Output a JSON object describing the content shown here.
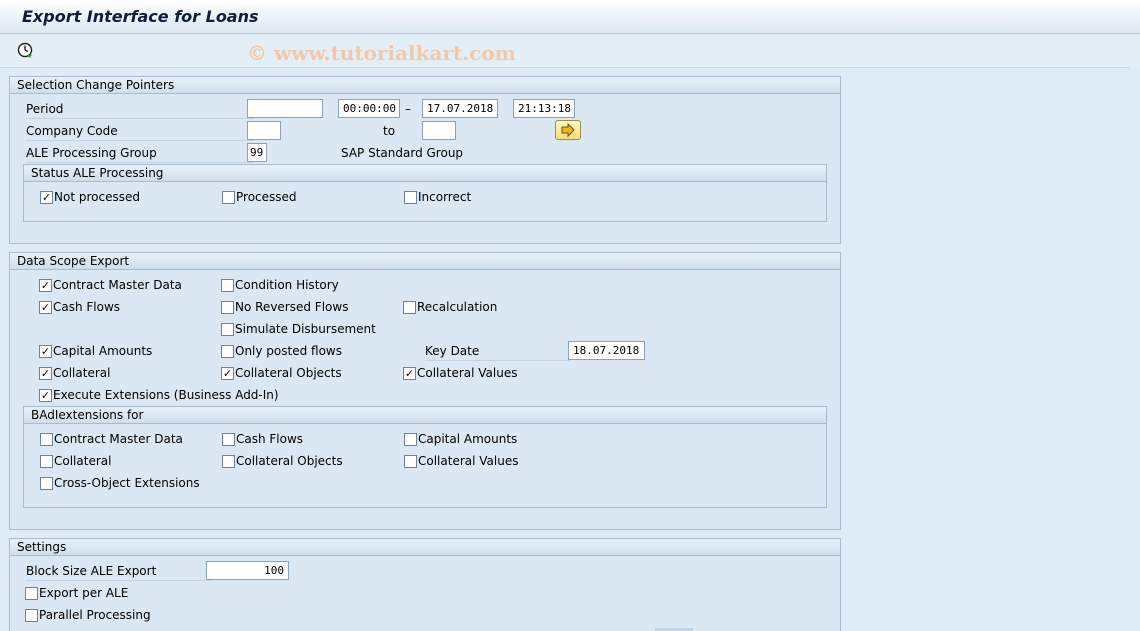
{
  "window": {
    "title": "Export Interface for Loans"
  },
  "toolbar": {
    "execute_icon": "clock-execute-icon",
    "watermark": "© www.tutorialkart.com"
  },
  "selection": {
    "frame_title": "Selection Change Pointers",
    "period_label": "Period",
    "period_from_date": "",
    "period_from_time": "00:00:00",
    "period_dash": "–",
    "period_to_date": "17.07.2018",
    "period_to_time": "21:13:18",
    "company_code_label": "Company Code",
    "company_code_from": "",
    "company_code_to_label": "to",
    "company_code_to": "",
    "ale_group_label": "ALE Processing Group",
    "ale_group_value": "99",
    "ale_group_text": "SAP Standard Group",
    "status_frame_title": "Status ALE Processing",
    "status": [
      {
        "label": "Not processed",
        "checked": true
      },
      {
        "label": "Processed",
        "checked": false
      },
      {
        "label": "Incorrect",
        "checked": false
      }
    ]
  },
  "scope": {
    "frame_title": "Data Scope Export",
    "items": {
      "contract_master_data": {
        "label": "Contract Master Data",
        "checked": true
      },
      "condition_history": {
        "label": "Condition History",
        "checked": false
      },
      "cash_flows": {
        "label": "Cash Flows",
        "checked": true
      },
      "no_reversed_flows": {
        "label": "No Reversed Flows",
        "checked": false
      },
      "recalculation": {
        "label": "Recalculation",
        "checked": false
      },
      "simulate_disbursement": {
        "label": "Simulate Disbursement",
        "checked": false
      },
      "capital_amounts": {
        "label": "Capital Amounts",
        "checked": true
      },
      "only_posted_flows": {
        "label": "Only posted flows",
        "checked": false
      },
      "collateral": {
        "label": "Collateral",
        "checked": true
      },
      "collateral_objects": {
        "label": "Collateral Objects",
        "checked": true
      },
      "collateral_values": {
        "label": "Collateral Values",
        "checked": true
      },
      "execute_extensions": {
        "label": "Execute Extensions (Business Add-In)",
        "checked": true
      }
    },
    "key_date_label": "Key Date",
    "key_date_value": "18.07.2018",
    "badi_frame_title": "BAdIextensions for",
    "badi": {
      "contract_master_data": {
        "label": "Contract Master Data",
        "checked": false
      },
      "cash_flows": {
        "label": "Cash Flows",
        "checked": false
      },
      "capital_amounts": {
        "label": "Capital Amounts",
        "checked": false
      },
      "collateral": {
        "label": "Collateral",
        "checked": false
      },
      "collateral_objects": {
        "label": "Collateral Objects",
        "checked": false
      },
      "collateral_values": {
        "label": "Collateral Values",
        "checked": false
      },
      "cross_object": {
        "label": "Cross-Object Extensions",
        "checked": false
      }
    }
  },
  "settings": {
    "frame_title": "Settings",
    "block_size_label": "Block Size ALE Export",
    "block_size_value": "100",
    "export_per_ale": {
      "label": "Export per ALE",
      "checked": false
    },
    "parallel_processing": {
      "label": "Parallel Processing",
      "checked": false
    }
  }
}
